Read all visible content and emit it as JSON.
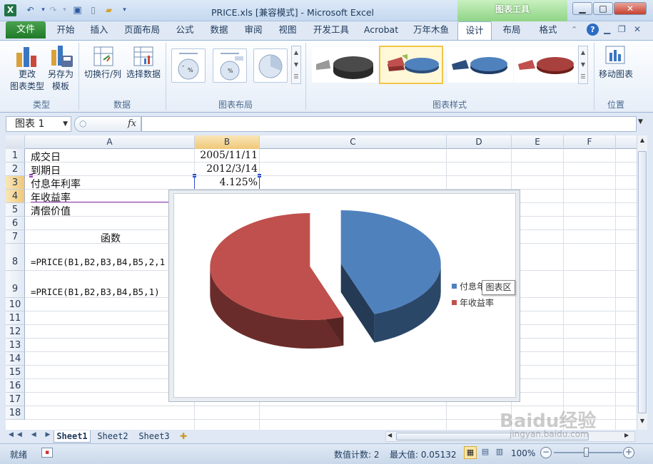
{
  "window": {
    "title": "PRICE.xls  [兼容模式] - Microsoft Excel",
    "context_tab_header": "图表工具"
  },
  "tabs": [
    "文件",
    "开始",
    "插入",
    "页面布局",
    "公式",
    "数据",
    "审阅",
    "视图",
    "开发工具",
    "Acrobat",
    "万年木鱼",
    "设计",
    "布局",
    "格式"
  ],
  "ribbon": {
    "change_type": "更改\n图表类型",
    "change_type_1": "更改",
    "change_type_2": "图表类型",
    "save_template_1": "另存为",
    "save_template_2": "模板",
    "switch_rowcol": "切换行/列",
    "select_data": "选择数据",
    "move_chart": "移动图表",
    "groups": {
      "type": "类型",
      "data": "数据",
      "layout": "图表布局",
      "styles": "图表样式",
      "location": "位置"
    }
  },
  "formula_bar": {
    "name_box": "图表 1",
    "fx": "fx",
    "formula": ""
  },
  "columns": [
    "A",
    "B",
    "C",
    "D",
    "E",
    "F"
  ],
  "rows": [
    "1",
    "2",
    "3",
    "4",
    "5",
    "6",
    "7",
    "8",
    "9",
    "10",
    "11",
    "12",
    "13",
    "14",
    "15",
    "16",
    "17",
    "18"
  ],
  "cells": {
    "A1": "成交日",
    "B1": "2005/11/11",
    "A2": "到期日",
    "B2": "2012/3/14",
    "A3": "付息年利率",
    "B3": "4.125%",
    "A4": "年收益率",
    "A5": "清偿价值",
    "A7": "函数",
    "A8": "=PRICE(B1,B2,B3,B4,B5,2,1",
    "A9": "=PRICE(B1,B2,B3,B4,B5,1)"
  },
  "chart_data": {
    "type": "pie",
    "title": "",
    "categories": [
      "付息年利率",
      "年收益率"
    ],
    "legend": [
      "付息年",
      "年收益率"
    ],
    "values": [
      4.125,
      5.132
    ],
    "colors": [
      "#4f81bd",
      "#c0504d"
    ],
    "legend_placement": "right"
  },
  "tooltip": "图表区",
  "sheets": [
    "Sheet1",
    "Sheet2",
    "Sheet3"
  ],
  "status": {
    "ready": "就绪",
    "count": "数值计数: 2",
    "max": "最大值: 0.05132",
    "zoom": "100%"
  },
  "watermark": "Baidu经验 jingyan.baidu.com"
}
